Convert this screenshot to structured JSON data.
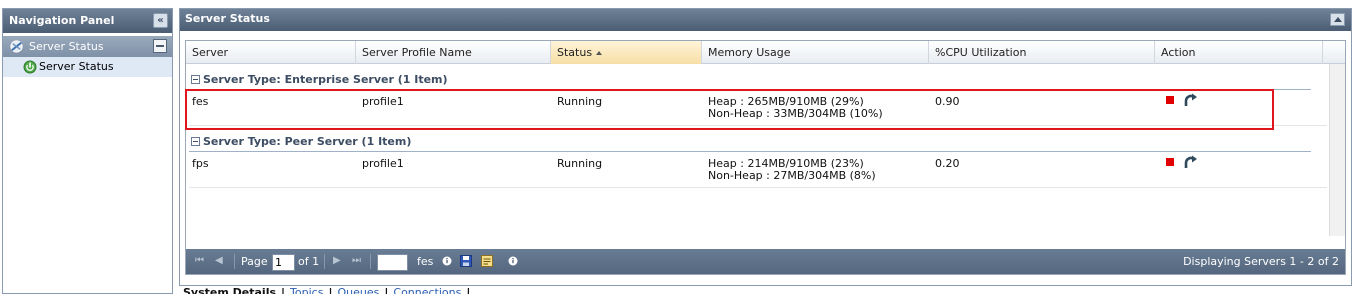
{
  "nav": {
    "title": "Navigation Panel",
    "group_label": "Server Status",
    "item_label": "Server Status"
  },
  "main": {
    "title": "Server Status",
    "columns": [
      "Server",
      "Server Profile Name",
      "Status",
      "Memory Usage",
      "%CPU Utilization",
      "Action"
    ],
    "groups": [
      {
        "title": "Server Type: Enterprise Server (1 Item)",
        "row": {
          "server": "fes",
          "profile": "profile1",
          "status": "Running",
          "heap": "Heap : 265MB/910MB (29%)",
          "nonheap": "Non-Heap : 33MB/304MB (10%)",
          "cpu": "0.90"
        }
      },
      {
        "title": "Server Type: Peer Server (1 Item)",
        "row": {
          "server": "fps",
          "profile": "profile1",
          "status": "Running",
          "heap": "Heap : 214MB/910MB (23%)",
          "nonheap": "Non-Heap : 27MB/304MB (8%)",
          "cpu": "0.20"
        }
      }
    ]
  },
  "pager": {
    "page_label": "Page",
    "page_value": "1",
    "of_label": "of 1",
    "server_label": "fes",
    "display_text": "Displaying Servers 1 - 2 of 2"
  },
  "bottom_links": {
    "active": "System Details",
    "separator": "|",
    "topics": "Topics",
    "queues": "Queues",
    "connections": "Connections"
  },
  "colors": {
    "header": "#4b5d73",
    "highlight": "#e0161d",
    "stop": "#e00000",
    "sorted_column": "#f7dfa6"
  }
}
